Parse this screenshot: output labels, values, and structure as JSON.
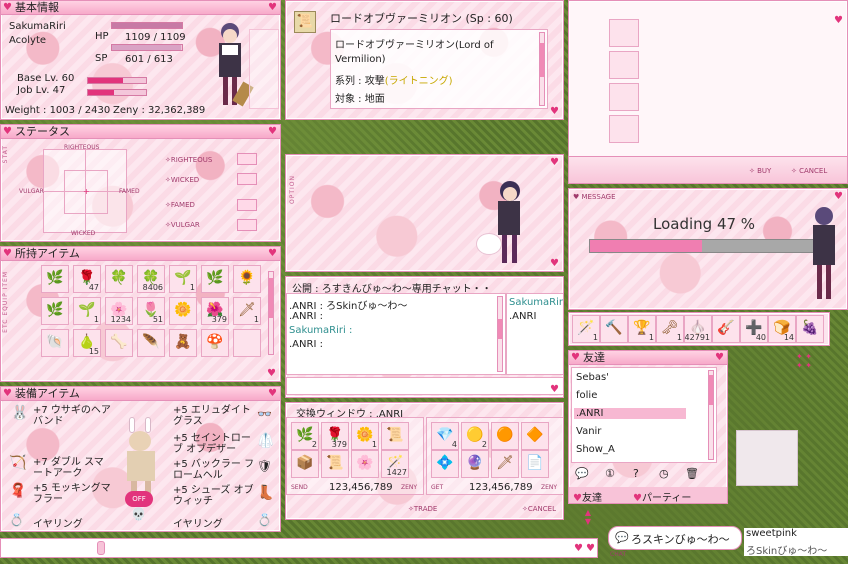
{
  "basic": {
    "title": "基本情報",
    "name": "SakumaRiri",
    "job": "Acolyte",
    "hp_label": "HP",
    "hp_value": "1109 / 1109",
    "hp_ratio": 1.0,
    "sp_label": "SP",
    "sp_value": "601 / 613",
    "sp_ratio": 0.98,
    "base_label": "Base Lv. 60",
    "base_ratio": 0.6,
    "job_label": "Job Lv. 47",
    "job_ratio": 0.45,
    "weight": "Weight : 1003 / 2430",
    "zeny": "Zeny : 32,362,389"
  },
  "skill": {
    "title": "ロードオブヴァーミリオン (Sp : 60)",
    "name1": "ロードオブヴァーミリオン(Lord of",
    "name2": "Vermilion)",
    "type_label": "系列 : 攻撃",
    "type_paren": "(ライトニング)",
    "target": "対象 : 地面"
  },
  "shop": {
    "buy_label": "BUY",
    "cancel_label": "CANCEL"
  },
  "status": {
    "title": "ステータス",
    "side": "STAT",
    "axis_top": "RIGHTEOUS",
    "axis_left": "VULGAR",
    "axis_right": "FAMED",
    "axis_bottom": "WICKED",
    "rows": [
      "RIGHTEOUS",
      "WICKED",
      "FAMED",
      "VULGAR"
    ]
  },
  "option": {
    "side": "OPTION"
  },
  "message": {
    "side": "MESSAGE",
    "loading_text": "Loading 47 %",
    "progress": 0.47
  },
  "inventory": {
    "title": "所持アイテム",
    "side": "ETC EQUIP ITEM",
    "rows": [
      [
        {
          "icon": "🌿",
          "count": ""
        },
        {
          "icon": "🌹",
          "count": "47"
        },
        {
          "icon": "🍀",
          "count": ""
        },
        {
          "icon": "🍀",
          "count": "8406"
        },
        {
          "icon": "🌱",
          "count": "1"
        },
        {
          "icon": "🌿",
          "count": ""
        },
        {
          "icon": "🌻",
          "count": ""
        }
      ],
      [
        {
          "icon": "🌿",
          "count": ""
        },
        {
          "icon": "🌱",
          "count": "1"
        },
        {
          "icon": "🌸",
          "count": "1234"
        },
        {
          "icon": "🌷",
          "count": "51"
        },
        {
          "icon": "🌼",
          "count": ""
        },
        {
          "icon": "🌺",
          "count": "379"
        },
        {
          "icon": "🗡",
          "count": "1"
        }
      ],
      [
        {
          "icon": "🐚",
          "count": ""
        },
        {
          "icon": "🍐",
          "count": "15"
        },
        {
          "icon": "🦴",
          "count": ""
        },
        {
          "icon": "🪶",
          "count": ""
        },
        {
          "icon": "🧸",
          "count": ""
        },
        {
          "icon": "🍄",
          "count": ""
        },
        {
          "icon": "",
          "count": ""
        }
      ]
    ]
  },
  "chat": {
    "title": "公開 : ろすきんびゅ〜わ〜専用チャット・・",
    "lines": [
      ".ANRI : ろSkinびゅ〜わ〜",
      ".ANRI :",
      "SakumaRiri :",
      ".ANRI :"
    ],
    "members": [
      "SakumaRir",
      ".ANRI"
    ]
  },
  "equip": {
    "title": "装備アイテム",
    "left": [
      "+7 ウサギのヘアバンド",
      "+7 ダブル スマートアーク",
      "+5 モッキングマフラー",
      "イヤリング"
    ],
    "right": [
      "+5 エリュダイトグラス",
      "+5 セイントローブ オブデザー",
      "+5 バックラー フロームヘル",
      "+5 シューズ オブ ウィッチ",
      "イヤリング"
    ],
    "off_label": "OFF"
  },
  "trade": {
    "title": "交換ウィンドウ : .ANRI",
    "send_label": "SEND",
    "get_label": "GET",
    "zeny_label": "ZENY",
    "send_zeny": "123,456,789",
    "get_zeny": "123,456,789",
    "trade_label": "TRADE",
    "cancel_label": "CANCEL",
    "send_items": [
      {
        "icon": "🌿",
        "count": "2"
      },
      {
        "icon": "🌹",
        "count": "379"
      },
      {
        "icon": "🌼",
        "count": "1"
      },
      {
        "icon": "📜",
        "count": ""
      },
      {
        "icon": "📦",
        "count": ""
      },
      {
        "icon": "📜",
        "count": ""
      },
      {
        "icon": "🌸",
        "count": ""
      },
      {
        "icon": "🪄",
        "count": "1427"
      }
    ],
    "get_items": [
      {
        "icon": "💎",
        "count": "4"
      },
      {
        "icon": "🟡",
        "count": "2"
      },
      {
        "icon": "🟠",
        "count": ""
      },
      {
        "icon": "🔶",
        "count": ""
      },
      {
        "icon": "💠",
        "count": ""
      },
      {
        "icon": "🔮",
        "count": ""
      },
      {
        "icon": "🗡",
        "count": ""
      },
      {
        "icon": "📄",
        "count": ""
      }
    ]
  },
  "hotbar": {
    "items": [
      {
        "icon": "🪄",
        "count": "1"
      },
      {
        "icon": "🔨",
        "count": ""
      },
      {
        "icon": "🏆",
        "count": "1"
      },
      {
        "icon": "🗝",
        "count": "1"
      },
      {
        "icon": "🧄",
        "count": "42791"
      },
      {
        "icon": "🎸",
        "count": ""
      },
      {
        "icon": "➕",
        "count": "40"
      },
      {
        "icon": "🍞",
        "count": "14"
      },
      {
        "icon": "🍇",
        "count": ""
      }
    ]
  },
  "friends": {
    "title": "友達",
    "list": [
      "Sebas'",
      "folie",
      ".ANRI",
      "Vanir",
      "Show_A"
    ],
    "selected_index": 2,
    "tab_friends": "友達",
    "tab_party": "パーティー"
  },
  "bottom": {
    "chat_label": "ろスキンびゅ〜わ〜",
    "chat_tag": "CHAT",
    "name_tag": "sweetpink",
    "name_tag2": "ろSkinびゅ〜わ〜"
  }
}
